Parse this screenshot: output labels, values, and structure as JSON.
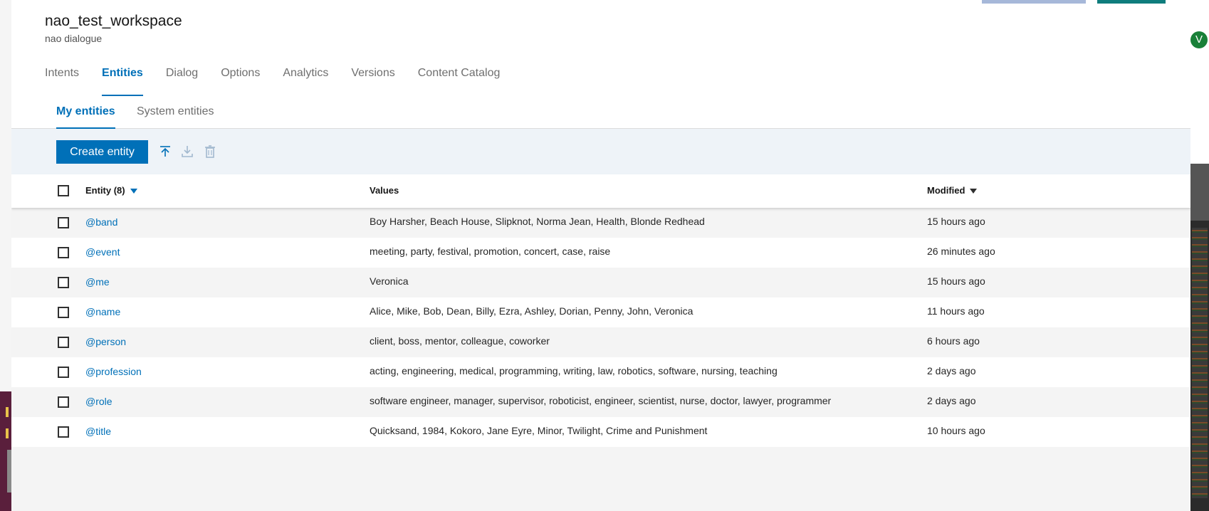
{
  "workspace": {
    "title": "nao_test_workspace",
    "subtitle": "nao dialogue"
  },
  "tabs": [
    {
      "label": "Intents",
      "active": false
    },
    {
      "label": "Entities",
      "active": true
    },
    {
      "label": "Dialog",
      "active": false
    },
    {
      "label": "Options",
      "active": false
    },
    {
      "label": "Analytics",
      "active": false
    },
    {
      "label": "Versions",
      "active": false
    },
    {
      "label": "Content Catalog",
      "active": false
    }
  ],
  "subtabs": {
    "my_entities": "My entities",
    "system_entities": "System entities"
  },
  "toolbar": {
    "create_label": "Create entity",
    "icons": [
      "upload-icon",
      "download-icon",
      "trash-icon"
    ]
  },
  "table": {
    "col_entity": "Entity (8)",
    "col_values": "Values",
    "col_modified": "Modified",
    "rows": [
      {
        "name": "@band",
        "values": "Boy Harsher, Beach House, Slipknot, Norma Jean, Health, Blonde Redhead",
        "modified": "15 hours ago"
      },
      {
        "name": "@event",
        "values": "meeting, party, festival, promotion, concert, case, raise",
        "modified": "26 minutes ago"
      },
      {
        "name": "@me",
        "values": "Veronica",
        "modified": "15 hours ago"
      },
      {
        "name": "@name",
        "values": "Alice, Mike, Bob, Dean, Billy, Ezra, Ashley, Dorian, Penny, John, Veronica",
        "modified": "11 hours ago"
      },
      {
        "name": "@person",
        "values": "client, boss, mentor, colleague, coworker",
        "modified": "6 hours ago"
      },
      {
        "name": "@profession",
        "values": "acting, engineering, medical, programming, writing, law, robotics, software, nursing, teaching",
        "modified": "2 days ago"
      },
      {
        "name": "@role",
        "values": "software engineer, manager, supervisor, roboticist, engineer, scientist, nurse, doctor, lawyer, programmer",
        "modified": "2 days ago"
      },
      {
        "name": "@title",
        "values": "Quicksand, 1984, Kokoro, Jane Eyre, Minor, Twilight, Crime and Punishment",
        "modified": "10 hours ago"
      }
    ]
  },
  "user": {
    "avatar_initial": "V"
  },
  "colors": {
    "accent": "#0070b8",
    "toolbar_bg": "#eef3f8",
    "avatar": "#198038"
  }
}
